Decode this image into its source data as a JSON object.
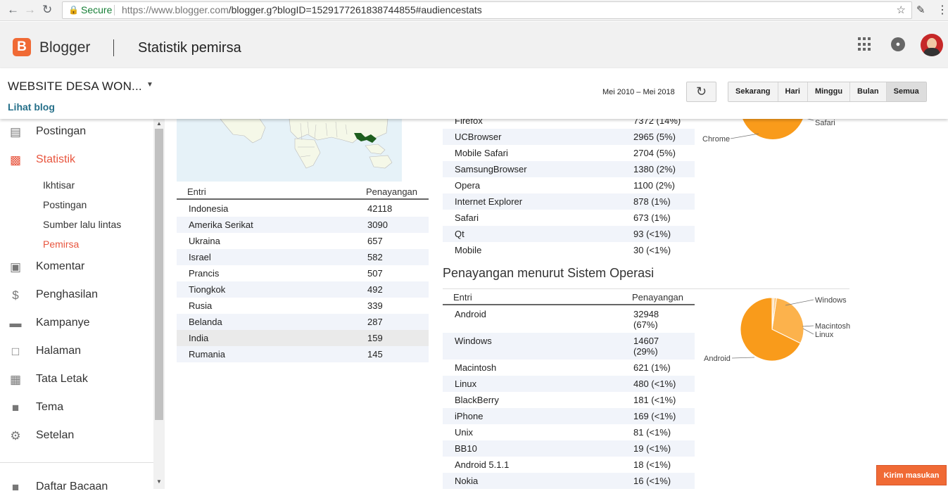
{
  "browser": {
    "secure_label": "Secure",
    "url_host": "https://www.blogger.com",
    "url_path": "/blogger.g?blogID=1529177261838744855#audiencestats"
  },
  "app": {
    "brand": "Blogger",
    "logo_letter": "B",
    "page_title": "Statistik pemirsa",
    "brand_color": "#f06a35"
  },
  "blog": {
    "name": "WEBSITE DESA WON...",
    "view_link": "Lihat blog"
  },
  "toolbar": {
    "date_range": "Mei 2010 – Mei 2018",
    "ranges": [
      "Sekarang",
      "Hari",
      "Minggu",
      "Bulan",
      "Semua"
    ],
    "selected_range": "Semua"
  },
  "sidebar": {
    "items": [
      {
        "label": "Postingan",
        "icon": "posts-icon"
      },
      {
        "label": "Statistik",
        "icon": "stats-icon"
      },
      {
        "label": "Komentar",
        "icon": "comment-icon"
      },
      {
        "label": "Penghasilan",
        "icon": "dollar-icon"
      },
      {
        "label": "Kampanye",
        "icon": "ad-icon"
      },
      {
        "label": "Halaman",
        "icon": "pages-icon"
      },
      {
        "label": "Tata Letak",
        "icon": "layout-icon"
      },
      {
        "label": "Tema",
        "icon": "theme-icon"
      },
      {
        "label": "Setelan",
        "icon": "gear-icon"
      },
      {
        "label": "Daftar Bacaan",
        "icon": "reading-list-icon"
      }
    ],
    "subitems": [
      "Ikhtisar",
      "Postingan",
      "Sumber lalu lintas",
      "Pemirsa"
    ],
    "active_item": "Statistik",
    "active_subitem": "Pemirsa"
  },
  "countries": {
    "col_entry": "Entri",
    "col_views": "Penayangan",
    "rows": [
      {
        "name": "Indonesia",
        "views": "42118"
      },
      {
        "name": "Amerika Serikat",
        "views": "3090"
      },
      {
        "name": "Ukraina",
        "views": "657"
      },
      {
        "name": "Israel",
        "views": "582"
      },
      {
        "name": "Prancis",
        "views": "507"
      },
      {
        "name": "Tiongkok",
        "views": "492"
      },
      {
        "name": "Rusia",
        "views": "339"
      },
      {
        "name": "Belanda",
        "views": "287"
      },
      {
        "name": "India",
        "views": "159"
      },
      {
        "name": "Rumania",
        "views": "145"
      }
    ]
  },
  "browsers": {
    "rows": [
      {
        "name": "Firefox",
        "views": "7372 (14%)"
      },
      {
        "name": "UCBrowser",
        "views": "2965 (5%)"
      },
      {
        "name": "Mobile Safari",
        "views": "2704 (5%)"
      },
      {
        "name": "SamsungBrowser",
        "views": "1380 (2%)"
      },
      {
        "name": "Opera",
        "views": "1100 (2%)"
      },
      {
        "name": "Internet Explorer",
        "views": "878 (1%)"
      },
      {
        "name": "Safari",
        "views": "673 (1%)"
      },
      {
        "name": "Qt",
        "views": "93 (<1%)"
      },
      {
        "name": "Mobile",
        "views": "30 (<1%)"
      }
    ],
    "pie_labels": [
      "Chrome",
      "Safari"
    ]
  },
  "os": {
    "title": "Penayangan menurut Sistem Operasi",
    "col_entry": "Entri",
    "col_views": "Penayangan",
    "rows": [
      {
        "name": "Android",
        "views": "32948",
        "pct": "(67%)"
      },
      {
        "name": "Windows",
        "views": "14607",
        "pct": "(29%)"
      },
      {
        "name": "Macintosh",
        "views": "621 (1%)",
        "pct": ""
      },
      {
        "name": "Linux",
        "views": "480 (<1%)",
        "pct": ""
      },
      {
        "name": "BlackBerry",
        "views": "181 (<1%)",
        "pct": ""
      },
      {
        "name": "iPhone",
        "views": "169 (<1%)",
        "pct": ""
      },
      {
        "name": "Unix",
        "views": "81 (<1%)",
        "pct": ""
      },
      {
        "name": "BB10",
        "views": "19 (<1%)",
        "pct": ""
      },
      {
        "name": "Android 5.1.1",
        "views": "18 (<1%)",
        "pct": ""
      },
      {
        "name": "Nokia",
        "views": "16 (<1%)",
        "pct": ""
      }
    ]
  },
  "chart_data": {
    "type": "pie",
    "slices": [
      {
        "label": "Android",
        "value": 32948,
        "color": "#f99b1b"
      },
      {
        "label": "Windows",
        "value": 14607,
        "color": "#fcb24c"
      },
      {
        "label": "Macintosh",
        "value": 621,
        "color": "#fcc77e"
      },
      {
        "label": "Linux",
        "value": 480,
        "color": "#fdd9a8"
      }
    ]
  },
  "feedback_label": "Kirim masukan"
}
